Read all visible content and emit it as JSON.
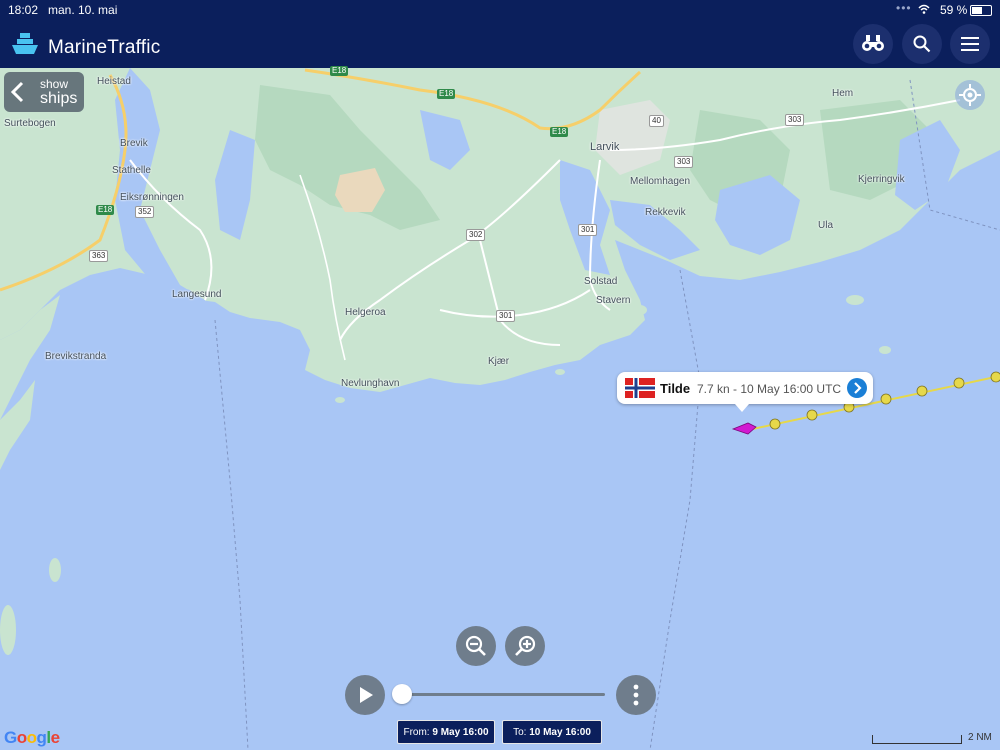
{
  "status_bar": {
    "time": "18:02",
    "date": "man. 10. mai",
    "battery": "59 %"
  },
  "app": {
    "title": "MarineTraffic"
  },
  "header_actions": {
    "binoculars": "binoculars-icon",
    "search": "search-icon",
    "menu": "hamburger-menu-icon"
  },
  "show_ships": {
    "line1": "show",
    "line2": "ships"
  },
  "places": [
    "Heistad",
    "Surtebogen",
    "Brevik",
    "Stathelle",
    "Eiksrønningen",
    "Langesund",
    "Brevikstranda",
    "Helgeroa",
    "Nevlunghavn",
    "Kjær",
    "Larvik",
    "Mellomhagen",
    "Rekkevik",
    "Solstad",
    "Stavern",
    "Hem",
    "Kjerringvik",
    "Ula"
  ],
  "road_shields": [
    "E18",
    "E18",
    "E18",
    "E18",
    "352",
    "363",
    "302",
    "301",
    "301",
    "303",
    "303",
    "40"
  ],
  "vessel_popup": {
    "name": "Tilde",
    "info": "7.7 kn - 10 May 16:00 UTC",
    "flag": "norway-flag"
  },
  "track_color": "#e6d84a",
  "vessel_color": "#d11ad1",
  "playback": {
    "from_label": "From:",
    "from_value": "9 May 16:00",
    "to_label": "To:",
    "to_value": "10 May 16:00",
    "progress": 0.0
  },
  "map_attribution": "Google",
  "scale_label": "2 NM"
}
